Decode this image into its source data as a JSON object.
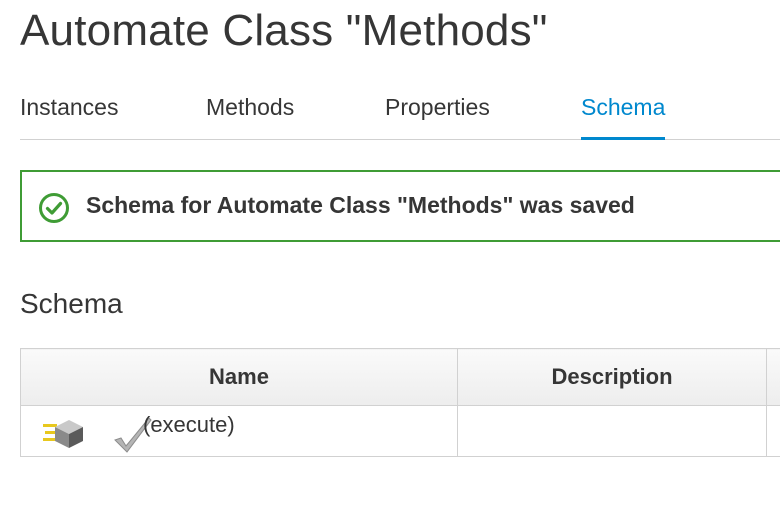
{
  "header": {
    "title": "Automate Class \"Methods\""
  },
  "tabs": [
    {
      "label": "Instances",
      "active": false
    },
    {
      "label": "Methods",
      "active": false
    },
    {
      "label": "Properties",
      "active": false
    },
    {
      "label": "Schema",
      "active": true
    }
  ],
  "alert": {
    "type": "success",
    "icon": "check-circle-icon",
    "message": "Schema for Automate Class \"Methods\" was saved",
    "color": "#3f9c35"
  },
  "schema": {
    "heading": "Schema",
    "columns": [
      "Name",
      "Description"
    ],
    "rows": [
      {
        "type_icon": "method-icon",
        "status_icon": "checkmark-icon",
        "name": "(execute)",
        "description": ""
      }
    ]
  },
  "colors": {
    "accent": "#0088ce",
    "success": "#3f9c35",
    "text": "#363636",
    "border": "#d1d1d1"
  }
}
